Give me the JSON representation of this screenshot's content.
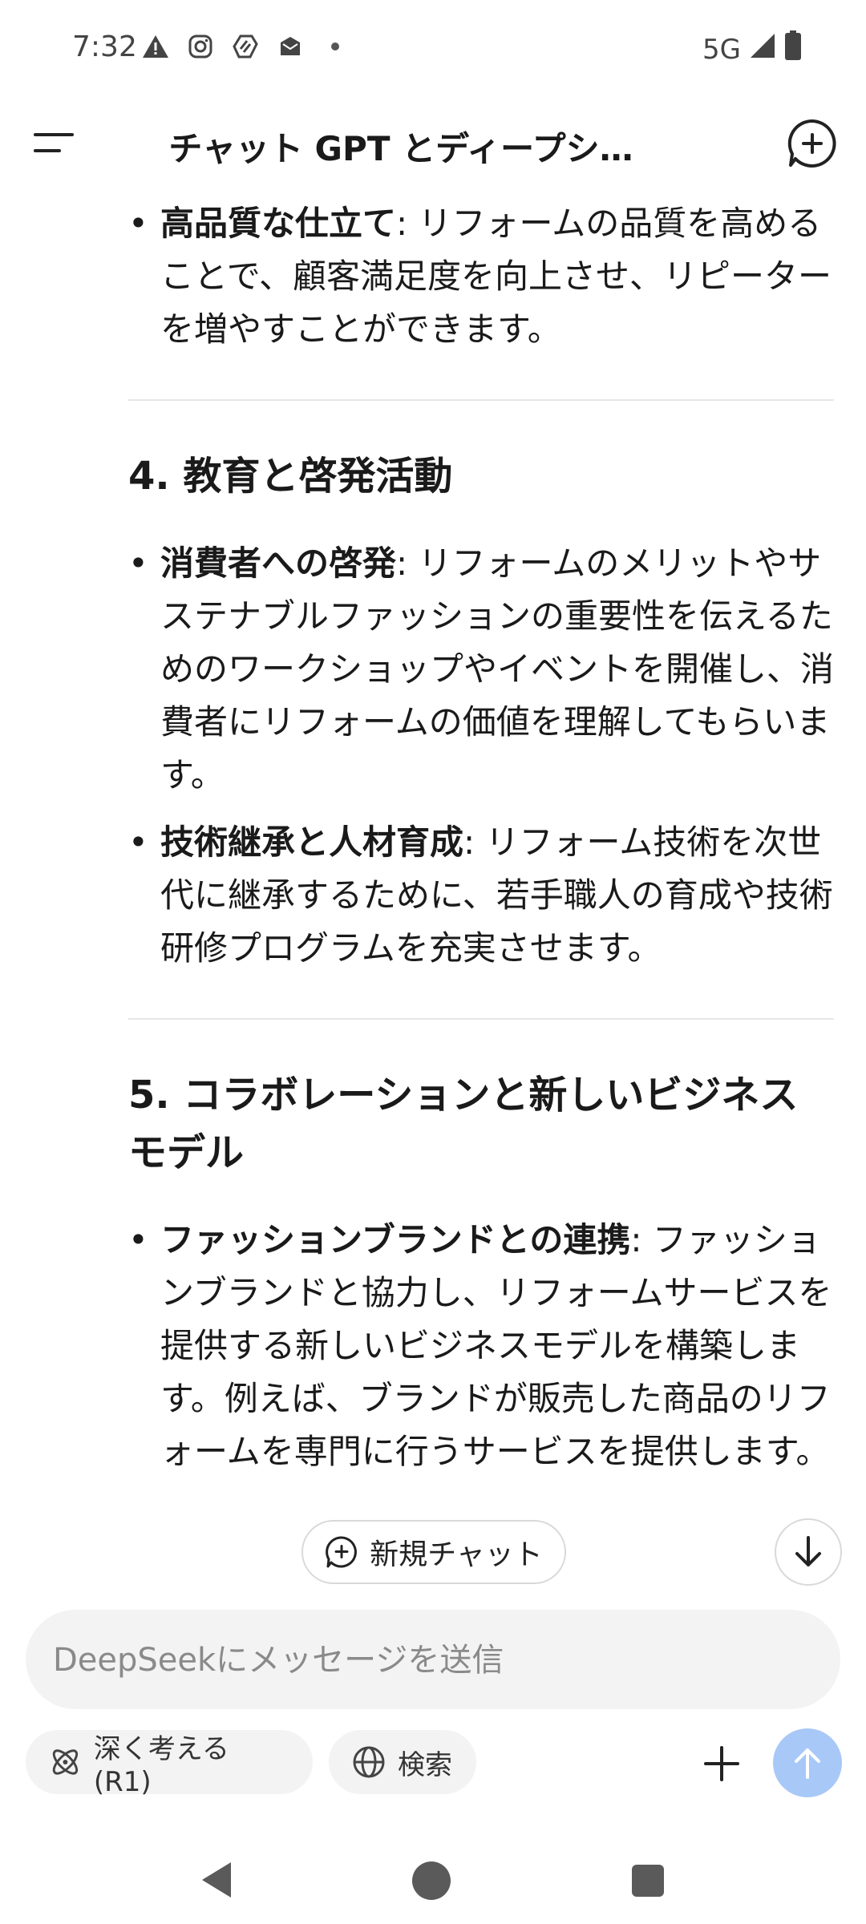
{
  "status_bar": {
    "time": "7:32",
    "network": "5G",
    "icons": [
      "warning-icon",
      "instagram-icon",
      "vpn-icon",
      "mail-icon",
      "dot-icon",
      "signal-icon",
      "battery-icon"
    ]
  },
  "header": {
    "title": "チャット GPT とディープシ…",
    "menu_icon": "menu-icon",
    "new_chat_icon": "new-chat-icon"
  },
  "content": {
    "section3_tail": {
      "bullet_bold": "高品質な仕立て",
      "bullet_text": ": リフォームの品質を高めることで、顧客満足度を向上させ、リピーターを増やすことができます。"
    },
    "section4": {
      "heading": "4. 教育と啓発活動",
      "bullets": [
        {
          "bold": "消費者への啓発",
          "text": ": リフォームのメリットやサステナブルファッションの重要性を伝えるためのワークショップやイベントを開催し、消費者にリフォームの価値を理解してもらいます。"
        },
        {
          "bold": "技術継承と人材育成",
          "text": ": リフォーム技術を次世代に継承するために、若手職人の育成や技術研修プログラムを充実させます。"
        }
      ]
    },
    "section5": {
      "heading": "5. コラボレーションと新しいビジネスモデル",
      "bullets": [
        {
          "bold": "ファッションブランドとの連携",
          "text": ": ファッションブランドと協力し、リフォームサービスを提供する新しいビジネスモデルを構築します。例えば、ブランドが販売した商品のリフォームを専門に行うサービスを提供します。"
        }
      ]
    }
  },
  "floating": {
    "new_chat_label": "新規チャット"
  },
  "composer": {
    "placeholder": "DeepSeekにメッセージを送信",
    "value": "",
    "deep_think_label": "深く考える (R1)",
    "search_label": "検索"
  },
  "colors": {
    "send_button": "#a8c8f8",
    "chip_bg": "#f3f3f3"
  }
}
